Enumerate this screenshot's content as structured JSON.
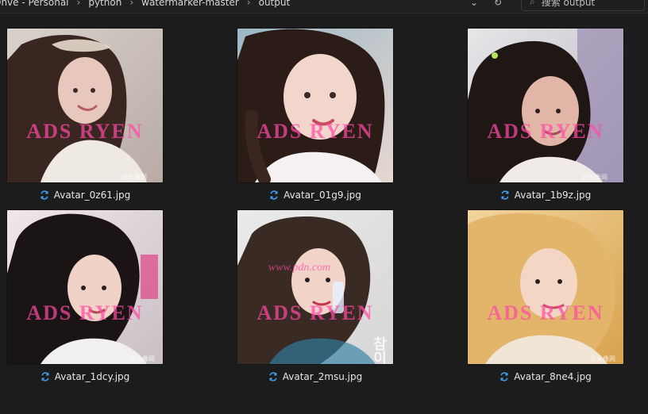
{
  "titlebar": {
    "breadcrumb": [
      "Onve - Personal",
      "python",
      "watermarker-master",
      "output"
    ]
  },
  "toolbar": {
    "dropdown_icon": "chevron-down-icon",
    "refresh_icon": "refresh-icon"
  },
  "search": {
    "value": "搜索 output"
  },
  "colors": {
    "accent": "#3ea6ff",
    "watermark": "#ff4aa6"
  },
  "gallery": {
    "items": [
      {
        "filename": "Avatar_0z61.jpg",
        "watermark": "ADS RYEN",
        "stamp": "@头像网"
      },
      {
        "filename": "Avatar_01g9.jpg",
        "watermark": "ADS RYEN"
      },
      {
        "filename": "Avatar_1b9z.jpg",
        "watermark": "ADS RYEN",
        "stamp": "@头像网"
      },
      {
        "filename": "Avatar_1dcy.jpg",
        "watermark": "ADS RYEN",
        "stamp": "@头像网"
      },
      {
        "filename": "Avatar_2msu.jpg",
        "watermark": "ADS RYEN",
        "extra_text": "www.pdn.com",
        "vertical_text": "참이슬"
      },
      {
        "filename": "Avatar_8ne4.jpg",
        "watermark": "ADS RYEN",
        "stamp": "@头像网"
      }
    ]
  }
}
